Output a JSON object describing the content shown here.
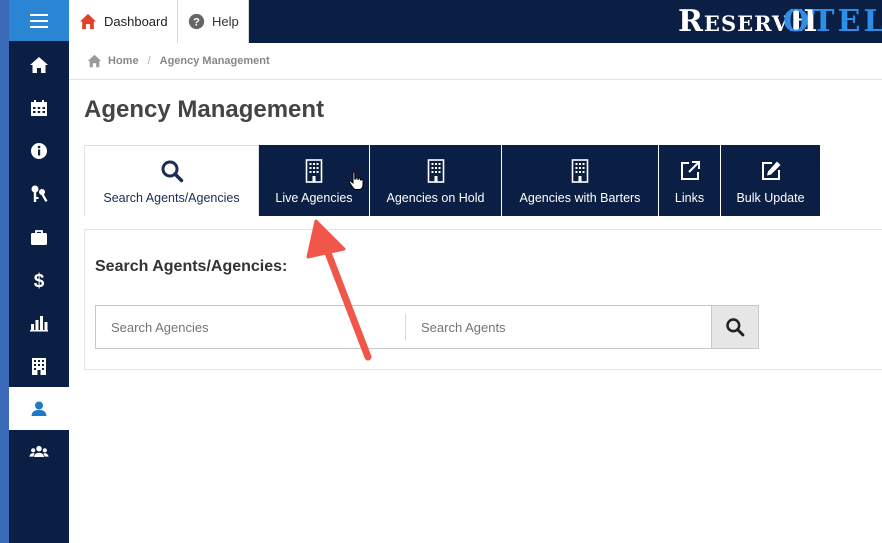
{
  "topbar": {
    "dashboard_label": "Dashboard",
    "help_label": "Help",
    "logo_part1": "ReservH",
    "logo_part2": "OTEL"
  },
  "sidebar": {
    "items": [
      {
        "icon": "home-icon"
      },
      {
        "icon": "calendar-icon"
      },
      {
        "icon": "info-icon"
      },
      {
        "icon": "keys-icon"
      },
      {
        "icon": "briefcase-icon"
      },
      {
        "icon": "dollar-icon"
      },
      {
        "icon": "bar-chart-icon"
      },
      {
        "icon": "building-icon"
      },
      {
        "icon": "user-icon",
        "active": true
      },
      {
        "icon": "users-icon"
      }
    ]
  },
  "breadcrumb": {
    "home": "Home",
    "separator": "/",
    "current": "Agency Management"
  },
  "page": {
    "title": "Agency Management"
  },
  "tabs": [
    {
      "label": "Search Agents/Agencies",
      "icon": "search-icon",
      "active": true
    },
    {
      "label": "Live Agencies",
      "icon": "building-icon"
    },
    {
      "label": "Agencies on Hold",
      "icon": "building-icon"
    },
    {
      "label": "Agencies with Barters",
      "icon": "building-icon"
    },
    {
      "label": "Links",
      "icon": "external-link-icon"
    },
    {
      "label": "Bulk Update",
      "icon": "edit-icon"
    }
  ],
  "search_panel": {
    "title": "Search Agents/Agencies:",
    "agencies_placeholder": "Search Agencies",
    "agents_placeholder": "Search Agents"
  },
  "colors": {
    "navy": "#0b1f45",
    "accent_blue": "#2a86d4",
    "arrow_red": "#f0564a"
  }
}
